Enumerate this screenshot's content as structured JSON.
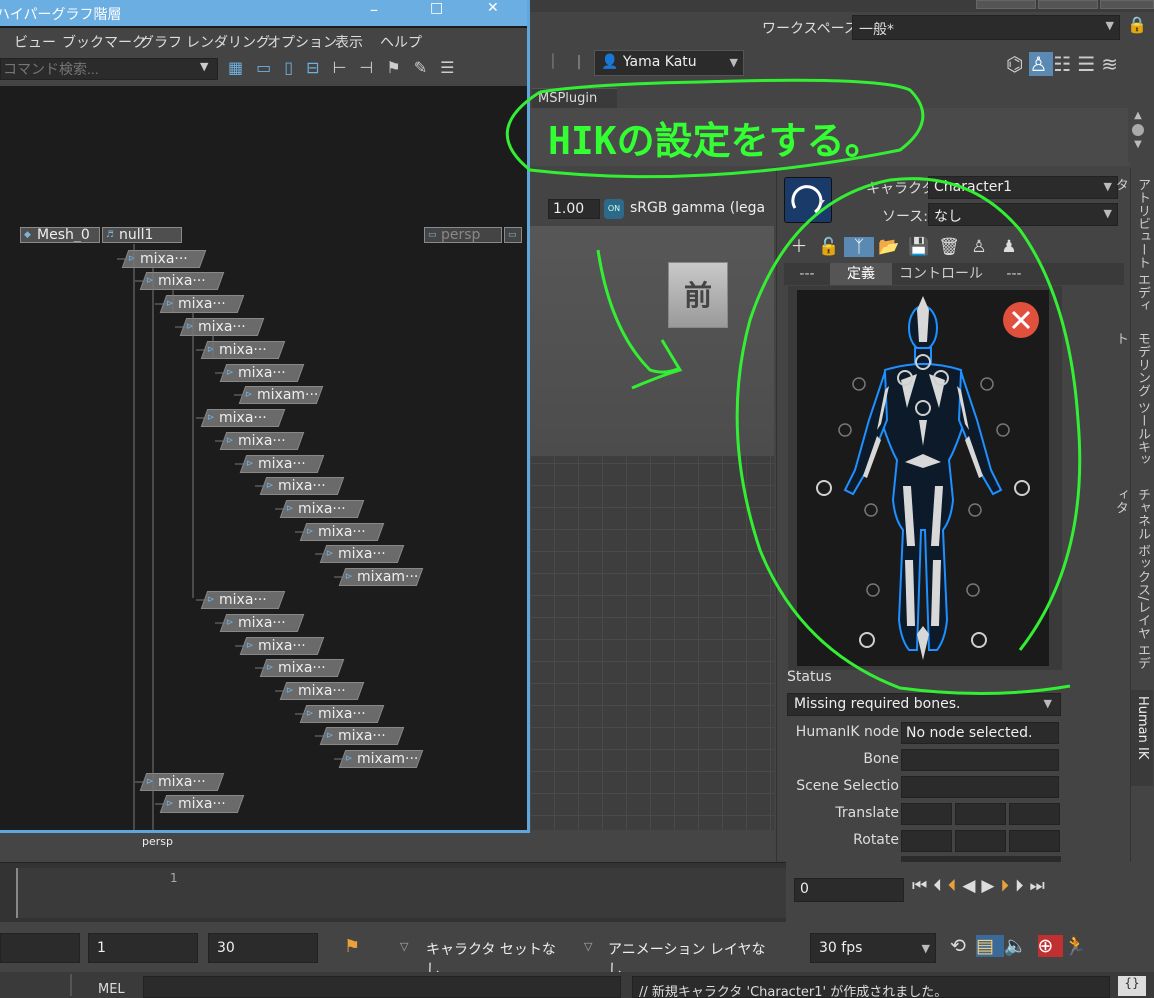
{
  "hypergraph": {
    "title": "ハイパーグラフ階層",
    "window_buttons": [
      "–",
      "□",
      "✕"
    ],
    "menu": [
      "ビュー",
      "ブックマーク",
      "グラフ",
      "レンダリング",
      "オプション",
      "表示",
      "ヘルプ"
    ],
    "command_search_placeholder": "コマンド検索...",
    "root_nodes": [
      "Mesh_0",
      "null1",
      "persp"
    ],
    "tree_nodes": [
      "mixa···",
      "mixa···",
      "mixa···",
      "mixa···",
      "mixa···",
      "mixa···",
      "mixam···",
      "mixa···",
      "mixa···",
      "mixa···",
      "mixa···",
      "mixa···",
      "mixa···",
      "mixa···",
      "mixam···",
      "mixa···",
      "mixa···",
      "mixa···",
      "mixa···",
      "mixa···",
      "mixa···",
      "mixa···",
      "mixam···",
      "mixa···",
      "mixa···"
    ]
  },
  "workspace": {
    "label": "ワークスペース:",
    "value": "一般*"
  },
  "user": {
    "name": "Yama Katu"
  },
  "shelf": {
    "tab": "MSPlugin"
  },
  "annotation": "HIKの設定をする。",
  "viewport": {
    "gamma_value": "1.00",
    "gamma_label": "sRGB gamma (lega",
    "view_cube_label": "前",
    "camera_label": "persp"
  },
  "human_ik": {
    "character_label": "キャラクタ:",
    "character_value": "Character1",
    "source_label": "ソース:",
    "source_value": "なし",
    "tabs": [
      "---",
      "定義",
      "コントロール",
      "---"
    ],
    "status_label": "Status",
    "status_value": "Missing required bones.",
    "properties": [
      {
        "label": "HumanIK node",
        "value": "No node selected."
      },
      {
        "label": "Bone",
        "value": ""
      },
      {
        "label": "Scene Selectio",
        "value": ""
      },
      {
        "label": "Translate",
        "value": ""
      },
      {
        "label": "Rotate",
        "value": ""
      }
    ]
  },
  "side_tabs": [
    "アトリビュート エディタ",
    "モデリング ツールキット",
    "チャネル ボックス/レイヤ エディタ",
    "Human IK"
  ],
  "timeline": {
    "start_tick": "1",
    "current_frame": "0"
  },
  "range": {
    "start": "1",
    "end": "30",
    "char_set": "キャラクタ セットなし",
    "anim_layer": "アニメーション レイヤなし",
    "fps": "30 fps"
  },
  "command_line": {
    "mode": "MEL",
    "result": "// 新規キャラクタ 'Character1' が作成されました。"
  },
  "colors": {
    "hypergraph_title": "#6baee2",
    "annotation": "#33ff33",
    "close_badge": "#e0503c",
    "figure_outline": "#1e90ff"
  },
  "icons": [
    "lock-icon",
    "user-icon",
    "search-icon",
    "close-icon",
    "play-icon",
    "loop-icon",
    "speaker-icon",
    "running-icon"
  ]
}
